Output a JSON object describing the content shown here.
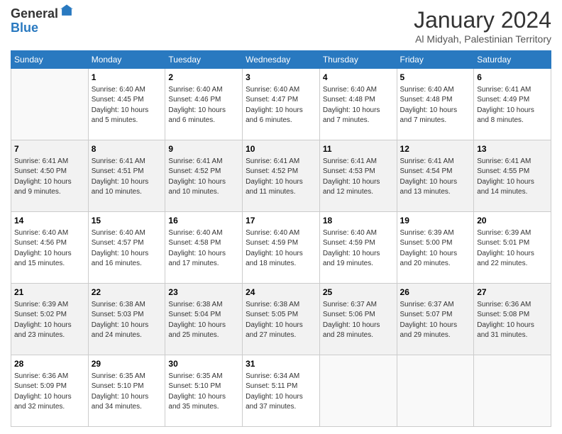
{
  "logo": {
    "general": "General",
    "blue": "Blue"
  },
  "header": {
    "title": "January 2024",
    "subtitle": "Al Midyah, Palestinian Territory"
  },
  "weekdays": [
    "Sunday",
    "Monday",
    "Tuesday",
    "Wednesday",
    "Thursday",
    "Friday",
    "Saturday"
  ],
  "weeks": [
    [
      {
        "day": "",
        "sunrise": "",
        "sunset": "",
        "daylight": ""
      },
      {
        "day": "1",
        "sunrise": "Sunrise: 6:40 AM",
        "sunset": "Sunset: 4:45 PM",
        "daylight": "Daylight: 10 hours and 5 minutes."
      },
      {
        "day": "2",
        "sunrise": "Sunrise: 6:40 AM",
        "sunset": "Sunset: 4:46 PM",
        "daylight": "Daylight: 10 hours and 6 minutes."
      },
      {
        "day": "3",
        "sunrise": "Sunrise: 6:40 AM",
        "sunset": "Sunset: 4:47 PM",
        "daylight": "Daylight: 10 hours and 6 minutes."
      },
      {
        "day": "4",
        "sunrise": "Sunrise: 6:40 AM",
        "sunset": "Sunset: 4:48 PM",
        "daylight": "Daylight: 10 hours and 7 minutes."
      },
      {
        "day": "5",
        "sunrise": "Sunrise: 6:40 AM",
        "sunset": "Sunset: 4:48 PM",
        "daylight": "Daylight: 10 hours and 7 minutes."
      },
      {
        "day": "6",
        "sunrise": "Sunrise: 6:41 AM",
        "sunset": "Sunset: 4:49 PM",
        "daylight": "Daylight: 10 hours and 8 minutes."
      }
    ],
    [
      {
        "day": "7",
        "sunrise": "Sunrise: 6:41 AM",
        "sunset": "Sunset: 4:50 PM",
        "daylight": "Daylight: 10 hours and 9 minutes."
      },
      {
        "day": "8",
        "sunrise": "Sunrise: 6:41 AM",
        "sunset": "Sunset: 4:51 PM",
        "daylight": "Daylight: 10 hours and 10 minutes."
      },
      {
        "day": "9",
        "sunrise": "Sunrise: 6:41 AM",
        "sunset": "Sunset: 4:52 PM",
        "daylight": "Daylight: 10 hours and 10 minutes."
      },
      {
        "day": "10",
        "sunrise": "Sunrise: 6:41 AM",
        "sunset": "Sunset: 4:52 PM",
        "daylight": "Daylight: 10 hours and 11 minutes."
      },
      {
        "day": "11",
        "sunrise": "Sunrise: 6:41 AM",
        "sunset": "Sunset: 4:53 PM",
        "daylight": "Daylight: 10 hours and 12 minutes."
      },
      {
        "day": "12",
        "sunrise": "Sunrise: 6:41 AM",
        "sunset": "Sunset: 4:54 PM",
        "daylight": "Daylight: 10 hours and 13 minutes."
      },
      {
        "day": "13",
        "sunrise": "Sunrise: 6:41 AM",
        "sunset": "Sunset: 4:55 PM",
        "daylight": "Daylight: 10 hours and 14 minutes."
      }
    ],
    [
      {
        "day": "14",
        "sunrise": "Sunrise: 6:40 AM",
        "sunset": "Sunset: 4:56 PM",
        "daylight": "Daylight: 10 hours and 15 minutes."
      },
      {
        "day": "15",
        "sunrise": "Sunrise: 6:40 AM",
        "sunset": "Sunset: 4:57 PM",
        "daylight": "Daylight: 10 hours and 16 minutes."
      },
      {
        "day": "16",
        "sunrise": "Sunrise: 6:40 AM",
        "sunset": "Sunset: 4:58 PM",
        "daylight": "Daylight: 10 hours and 17 minutes."
      },
      {
        "day": "17",
        "sunrise": "Sunrise: 6:40 AM",
        "sunset": "Sunset: 4:59 PM",
        "daylight": "Daylight: 10 hours and 18 minutes."
      },
      {
        "day": "18",
        "sunrise": "Sunrise: 6:40 AM",
        "sunset": "Sunset: 4:59 PM",
        "daylight": "Daylight: 10 hours and 19 minutes."
      },
      {
        "day": "19",
        "sunrise": "Sunrise: 6:39 AM",
        "sunset": "Sunset: 5:00 PM",
        "daylight": "Daylight: 10 hours and 20 minutes."
      },
      {
        "day": "20",
        "sunrise": "Sunrise: 6:39 AM",
        "sunset": "Sunset: 5:01 PM",
        "daylight": "Daylight: 10 hours and 22 minutes."
      }
    ],
    [
      {
        "day": "21",
        "sunrise": "Sunrise: 6:39 AM",
        "sunset": "Sunset: 5:02 PM",
        "daylight": "Daylight: 10 hours and 23 minutes."
      },
      {
        "day": "22",
        "sunrise": "Sunrise: 6:38 AM",
        "sunset": "Sunset: 5:03 PM",
        "daylight": "Daylight: 10 hours and 24 minutes."
      },
      {
        "day": "23",
        "sunrise": "Sunrise: 6:38 AM",
        "sunset": "Sunset: 5:04 PM",
        "daylight": "Daylight: 10 hours and 25 minutes."
      },
      {
        "day": "24",
        "sunrise": "Sunrise: 6:38 AM",
        "sunset": "Sunset: 5:05 PM",
        "daylight": "Daylight: 10 hours and 27 minutes."
      },
      {
        "day": "25",
        "sunrise": "Sunrise: 6:37 AM",
        "sunset": "Sunset: 5:06 PM",
        "daylight": "Daylight: 10 hours and 28 minutes."
      },
      {
        "day": "26",
        "sunrise": "Sunrise: 6:37 AM",
        "sunset": "Sunset: 5:07 PM",
        "daylight": "Daylight: 10 hours and 29 minutes."
      },
      {
        "day": "27",
        "sunrise": "Sunrise: 6:36 AM",
        "sunset": "Sunset: 5:08 PM",
        "daylight": "Daylight: 10 hours and 31 minutes."
      }
    ],
    [
      {
        "day": "28",
        "sunrise": "Sunrise: 6:36 AM",
        "sunset": "Sunset: 5:09 PM",
        "daylight": "Daylight: 10 hours and 32 minutes."
      },
      {
        "day": "29",
        "sunrise": "Sunrise: 6:35 AM",
        "sunset": "Sunset: 5:10 PM",
        "daylight": "Daylight: 10 hours and 34 minutes."
      },
      {
        "day": "30",
        "sunrise": "Sunrise: 6:35 AM",
        "sunset": "Sunset: 5:10 PM",
        "daylight": "Daylight: 10 hours and 35 minutes."
      },
      {
        "day": "31",
        "sunrise": "Sunrise: 6:34 AM",
        "sunset": "Sunset: 5:11 PM",
        "daylight": "Daylight: 10 hours and 37 minutes."
      },
      {
        "day": "",
        "sunrise": "",
        "sunset": "",
        "daylight": ""
      },
      {
        "day": "",
        "sunrise": "",
        "sunset": "",
        "daylight": ""
      },
      {
        "day": "",
        "sunrise": "",
        "sunset": "",
        "daylight": ""
      }
    ]
  ]
}
